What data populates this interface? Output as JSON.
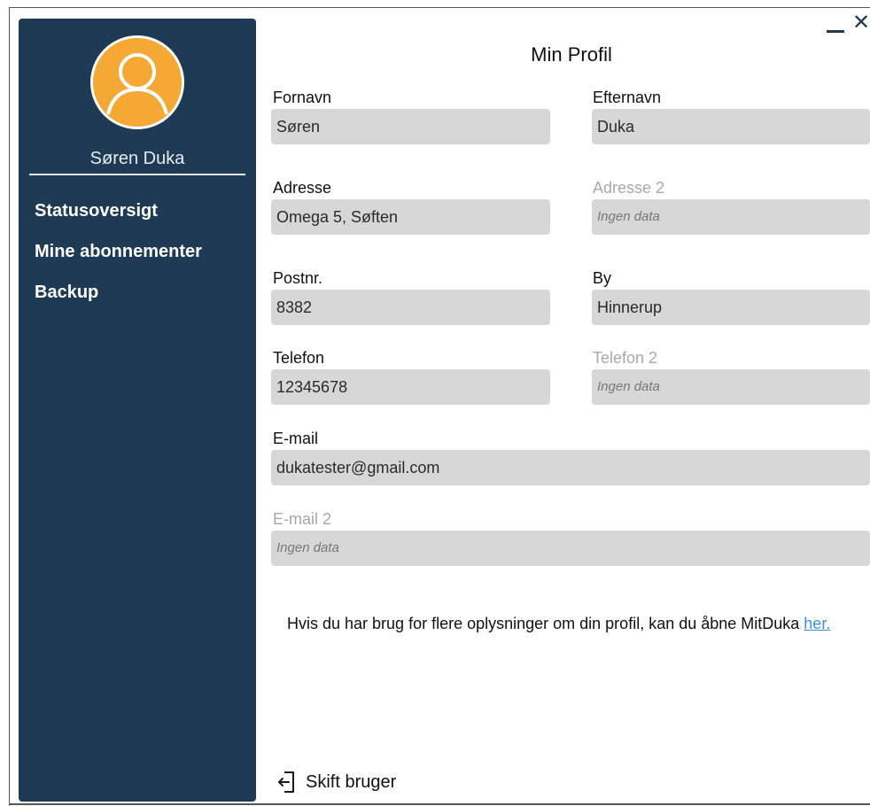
{
  "window": {
    "minimize_icon": "minimize-icon",
    "close_icon": "close-icon",
    "close_glyph": "✕"
  },
  "sidebar": {
    "user_name": "Søren Duka",
    "avatar_icon": "user-avatar-icon",
    "avatar_color": "#f5a833",
    "background": "#1e3a55",
    "items": [
      {
        "label": "Statusoversigt"
      },
      {
        "label": "Mine abonnementer"
      },
      {
        "label": "Backup"
      }
    ]
  },
  "profile": {
    "title": "Min Profil",
    "fields": {
      "fornavn": {
        "label": "Fornavn",
        "value": "Søren"
      },
      "efternavn": {
        "label": "Efternavn",
        "value": "Duka"
      },
      "adresse": {
        "label": "Adresse",
        "value": "Omega 5, Søften"
      },
      "adresse2": {
        "label": "Adresse 2",
        "value": "Ingen data"
      },
      "postnr": {
        "label": "Postnr.",
        "value": "8382"
      },
      "by": {
        "label": "By",
        "value": "Hinnerup"
      },
      "telefon": {
        "label": "Telefon",
        "value": "12345678"
      },
      "telefon2": {
        "label": "Telefon 2",
        "value": "Ingen data"
      },
      "email": {
        "label": "E-mail",
        "value": "dukatester@gmail.com"
      },
      "email2": {
        "label": "E-mail 2",
        "value": "Ingen data"
      }
    },
    "info_text": "Hvis du har brug for flere oplysninger om din profil, kan du åbne MitDuka ",
    "info_link": "her.",
    "link_color": "#3a8fd6"
  },
  "footer": {
    "switch_user_label": "Skift bruger",
    "switch_user_icon": "sign-out-icon"
  }
}
